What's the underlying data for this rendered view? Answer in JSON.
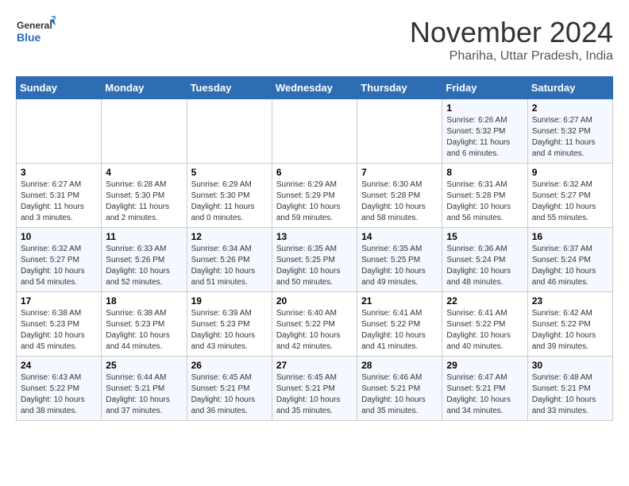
{
  "header": {
    "logo_text_top": "General",
    "logo_text_bottom": "Blue",
    "month": "November 2024",
    "location": "Phariha, Uttar Pradesh, India"
  },
  "weekdays": [
    "Sunday",
    "Monday",
    "Tuesday",
    "Wednesday",
    "Thursday",
    "Friday",
    "Saturday"
  ],
  "weeks": [
    [
      {
        "day": "",
        "info": ""
      },
      {
        "day": "",
        "info": ""
      },
      {
        "day": "",
        "info": ""
      },
      {
        "day": "",
        "info": ""
      },
      {
        "day": "",
        "info": ""
      },
      {
        "day": "1",
        "info": "Sunrise: 6:26 AM\nSunset: 5:32 PM\nDaylight: 11 hours and 6 minutes."
      },
      {
        "day": "2",
        "info": "Sunrise: 6:27 AM\nSunset: 5:32 PM\nDaylight: 11 hours and 4 minutes."
      }
    ],
    [
      {
        "day": "3",
        "info": "Sunrise: 6:27 AM\nSunset: 5:31 PM\nDaylight: 11 hours and 3 minutes."
      },
      {
        "day": "4",
        "info": "Sunrise: 6:28 AM\nSunset: 5:30 PM\nDaylight: 11 hours and 2 minutes."
      },
      {
        "day": "5",
        "info": "Sunrise: 6:29 AM\nSunset: 5:30 PM\nDaylight: 11 hours and 0 minutes."
      },
      {
        "day": "6",
        "info": "Sunrise: 6:29 AM\nSunset: 5:29 PM\nDaylight: 10 hours and 59 minutes."
      },
      {
        "day": "7",
        "info": "Sunrise: 6:30 AM\nSunset: 5:28 PM\nDaylight: 10 hours and 58 minutes."
      },
      {
        "day": "8",
        "info": "Sunrise: 6:31 AM\nSunset: 5:28 PM\nDaylight: 10 hours and 56 minutes."
      },
      {
        "day": "9",
        "info": "Sunrise: 6:32 AM\nSunset: 5:27 PM\nDaylight: 10 hours and 55 minutes."
      }
    ],
    [
      {
        "day": "10",
        "info": "Sunrise: 6:32 AM\nSunset: 5:27 PM\nDaylight: 10 hours and 54 minutes."
      },
      {
        "day": "11",
        "info": "Sunrise: 6:33 AM\nSunset: 5:26 PM\nDaylight: 10 hours and 52 minutes."
      },
      {
        "day": "12",
        "info": "Sunrise: 6:34 AM\nSunset: 5:26 PM\nDaylight: 10 hours and 51 minutes."
      },
      {
        "day": "13",
        "info": "Sunrise: 6:35 AM\nSunset: 5:25 PM\nDaylight: 10 hours and 50 minutes."
      },
      {
        "day": "14",
        "info": "Sunrise: 6:35 AM\nSunset: 5:25 PM\nDaylight: 10 hours and 49 minutes."
      },
      {
        "day": "15",
        "info": "Sunrise: 6:36 AM\nSunset: 5:24 PM\nDaylight: 10 hours and 48 minutes."
      },
      {
        "day": "16",
        "info": "Sunrise: 6:37 AM\nSunset: 5:24 PM\nDaylight: 10 hours and 46 minutes."
      }
    ],
    [
      {
        "day": "17",
        "info": "Sunrise: 6:38 AM\nSunset: 5:23 PM\nDaylight: 10 hours and 45 minutes."
      },
      {
        "day": "18",
        "info": "Sunrise: 6:38 AM\nSunset: 5:23 PM\nDaylight: 10 hours and 44 minutes."
      },
      {
        "day": "19",
        "info": "Sunrise: 6:39 AM\nSunset: 5:23 PM\nDaylight: 10 hours and 43 minutes."
      },
      {
        "day": "20",
        "info": "Sunrise: 6:40 AM\nSunset: 5:22 PM\nDaylight: 10 hours and 42 minutes."
      },
      {
        "day": "21",
        "info": "Sunrise: 6:41 AM\nSunset: 5:22 PM\nDaylight: 10 hours and 41 minutes."
      },
      {
        "day": "22",
        "info": "Sunrise: 6:41 AM\nSunset: 5:22 PM\nDaylight: 10 hours and 40 minutes."
      },
      {
        "day": "23",
        "info": "Sunrise: 6:42 AM\nSunset: 5:22 PM\nDaylight: 10 hours and 39 minutes."
      }
    ],
    [
      {
        "day": "24",
        "info": "Sunrise: 6:43 AM\nSunset: 5:22 PM\nDaylight: 10 hours and 38 minutes."
      },
      {
        "day": "25",
        "info": "Sunrise: 6:44 AM\nSunset: 5:21 PM\nDaylight: 10 hours and 37 minutes."
      },
      {
        "day": "26",
        "info": "Sunrise: 6:45 AM\nSunset: 5:21 PM\nDaylight: 10 hours and 36 minutes."
      },
      {
        "day": "27",
        "info": "Sunrise: 6:45 AM\nSunset: 5:21 PM\nDaylight: 10 hours and 35 minutes."
      },
      {
        "day": "28",
        "info": "Sunrise: 6:46 AM\nSunset: 5:21 PM\nDaylight: 10 hours and 35 minutes."
      },
      {
        "day": "29",
        "info": "Sunrise: 6:47 AM\nSunset: 5:21 PM\nDaylight: 10 hours and 34 minutes."
      },
      {
        "day": "30",
        "info": "Sunrise: 6:48 AM\nSunset: 5:21 PM\nDaylight: 10 hours and 33 minutes."
      }
    ]
  ]
}
